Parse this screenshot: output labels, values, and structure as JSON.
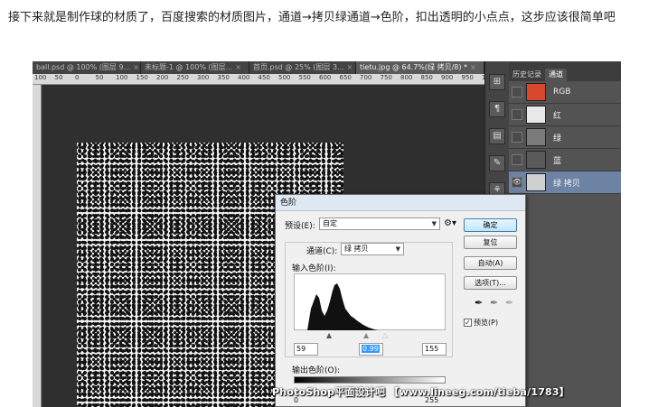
{
  "article": {
    "text": "接下来就是制作球的材质了，百度搜索的材质图片，通道→拷贝绿通道→色阶，扣出透明的小点点，这步应该很简单吧"
  },
  "photoshop": {
    "tabs": [
      {
        "label": "ball.psd @ 100% (图层 9...",
        "close": "×"
      },
      {
        "label": "未标题-1 @ 100% (图层...",
        "close": "×"
      },
      {
        "label": "首页.psd @ 25% (图层 3...",
        "close": "×"
      },
      {
        "label": "tietu.jpg @ 64.7%(绿 拷贝/8) *",
        "close": "×"
      }
    ],
    "ruler_ticks": [
      "100",
      "50",
      "0",
      "50",
      "100",
      "150",
      "200",
      "250",
      "300",
      "350",
      "400",
      "450",
      "500",
      "550",
      "600",
      "650",
      "700",
      "750",
      "800",
      "850",
      "900",
      "950",
      "1000"
    ],
    "channels_panel": {
      "tabs": [
        "历史记录",
        "通道"
      ],
      "channels": [
        {
          "name": "RGB",
          "thumb_color": "#d8482c",
          "visible": false,
          "selected": false
        },
        {
          "name": "红",
          "thumb_color": "#e8e8e8",
          "visible": false,
          "selected": false
        },
        {
          "name": "绿",
          "thumb_color": "#7a7a7a",
          "visible": false,
          "selected": false
        },
        {
          "name": "蓝",
          "thumb_color": "#5a5a5a",
          "visible": false,
          "selected": false
        },
        {
          "name": "绿 拷贝",
          "thumb_color": "#d0d0d0",
          "visible": true,
          "selected": true
        }
      ]
    }
  },
  "levels_dialog": {
    "title": "色阶",
    "preset_label": "预设(E):",
    "preset_value": "自定",
    "channel_label": "通道(C):",
    "channel_value": "绿 拷贝",
    "input_levels_label": "输入色阶(I):",
    "input_values": {
      "black": "59",
      "gamma": "0.99",
      "white": "155"
    },
    "output_levels_label": "输出色阶(O):",
    "output_values": {
      "black": "0",
      "white": "255"
    },
    "buttons": {
      "ok": "确定",
      "reset": "复位",
      "auto": "自动(A)",
      "options": "选项(T)..."
    },
    "preview_label": "预览(P)",
    "preview_checked": true
  },
  "watermark": {
    "text": "PhotoShop平面设计吧 【www.lineeg.com/tieba/1783】"
  },
  "colors": {
    "ps_dark": "#535353",
    "selected_channel": "#6d83a4",
    "default_button": "#3c7fb1"
  }
}
